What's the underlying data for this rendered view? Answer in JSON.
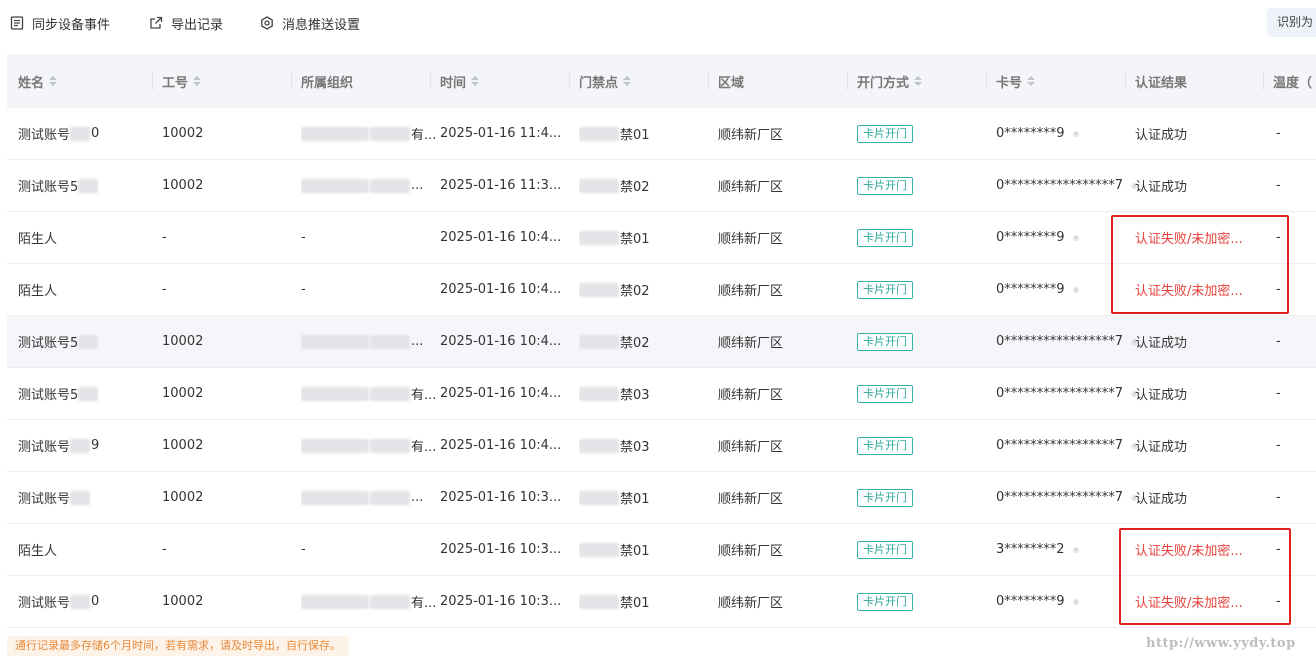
{
  "toolbar": {
    "sync_label": "同步设备事件",
    "export_label": "导出记录",
    "push_label": "消息推送设置",
    "identify_label": "识别为"
  },
  "columns": [
    "姓名",
    "工号",
    "所属组织",
    "时间",
    "门禁点",
    "区域",
    "开门方式",
    "卡号",
    "认证结果",
    "温度（"
  ],
  "rows": [
    {
      "name": "测试账号",
      "name_tail": "0",
      "emp_id": "10002",
      "org_tail": "有...",
      "time": "2025-01-16 11:4...",
      "door_tail": "禁01",
      "area": "顺纬新厂区",
      "method": "卡片开门",
      "card": "0********9",
      "result": "认证成功",
      "result_status": "success",
      "temp": "-"
    },
    {
      "name": "测试账号5",
      "name_tail": "",
      "emp_id": "10002",
      "org_tail": "...",
      "time": "2025-01-16 11:3...",
      "door_tail": "禁02",
      "area": "顺纬新厂区",
      "method": "卡片开门",
      "card": "0*****************7",
      "result": "认证成功",
      "result_status": "success",
      "temp": "-"
    },
    {
      "name": "陌生人",
      "name_tail": "",
      "emp_id": "-",
      "org_tail": "-",
      "time": "2025-01-16 10:4...",
      "door_tail": "禁01",
      "area": "顺纬新厂区",
      "method": "卡片开门",
      "card": "0********9",
      "result": "认证失败/未加密...",
      "result_status": "fail",
      "temp": "-"
    },
    {
      "name": "陌生人",
      "name_tail": "",
      "emp_id": "-",
      "org_tail": "-",
      "time": "2025-01-16 10:4...",
      "door_tail": "禁02",
      "area": "顺纬新厂区",
      "method": "卡片开门",
      "card": "0********9",
      "result": "认证失败/未加密...",
      "result_status": "fail",
      "temp": "-"
    },
    {
      "name": "测试账号5",
      "name_tail": "",
      "emp_id": "10002",
      "org_tail": "...",
      "time": "2025-01-16 10:4...",
      "door_tail": "禁02",
      "area": "顺纬新厂区",
      "method": "卡片开门",
      "card": "0*****************7",
      "result": "认证成功",
      "result_status": "success",
      "temp": "-"
    },
    {
      "name": "测试账号5",
      "name_tail": "",
      "emp_id": "10002",
      "org_tail": "有...",
      "time": "2025-01-16 10:4...",
      "door_tail": "禁03",
      "area": "顺纬新厂区",
      "method": "卡片开门",
      "card": "0*****************7",
      "result": "认证成功",
      "result_status": "success",
      "temp": "-"
    },
    {
      "name": "测试账号",
      "name_tail": "9",
      "emp_id": "10002",
      "org_tail": "有...",
      "time": "2025-01-16 10:4...",
      "door_tail": "禁03",
      "area": "顺纬新厂区",
      "method": "卡片开门",
      "card": "0*****************7",
      "result": "认证成功",
      "result_status": "success",
      "temp": "-"
    },
    {
      "name": "测试账号",
      "name_tail": "",
      "emp_id": "10002",
      "org_tail": "...",
      "time": "2025-01-16 10:3...",
      "door_tail": "禁01",
      "area": "顺纬新厂区",
      "method": "卡片开门",
      "card": "0*****************7",
      "result": "认证成功",
      "result_status": "success",
      "temp": "-"
    },
    {
      "name": "陌生人",
      "name_tail": "",
      "emp_id": "-",
      "org_tail": "-",
      "time": "2025-01-16 10:3...",
      "door_tail": "禁01",
      "area": "顺纬新厂区",
      "method": "卡片开门",
      "card": "3********2",
      "result": "认证失败/未加密...",
      "result_status": "fail",
      "temp": "-"
    },
    {
      "name": "测试账号",
      "name_tail": "0",
      "emp_id": "10002",
      "org_tail": "有...",
      "time": "2025-01-16 10:3...",
      "door_tail": "禁01",
      "area": "顺纬新厂区",
      "method": "卡片开门",
      "card": "0********9",
      "result": "认证失败/未加密...",
      "result_status": "fail",
      "temp": "-"
    }
  ],
  "footnote": "通行记录最多存储6个月时间，若有需求，请及时导出，自行保存。",
  "watermark": "http://www.yydy.top",
  "colors": {
    "accent_teal": "#2aa79c",
    "fail_red": "#e8403a",
    "highlight_box": "#e0201f",
    "header_bg": "#f4f5f8"
  }
}
